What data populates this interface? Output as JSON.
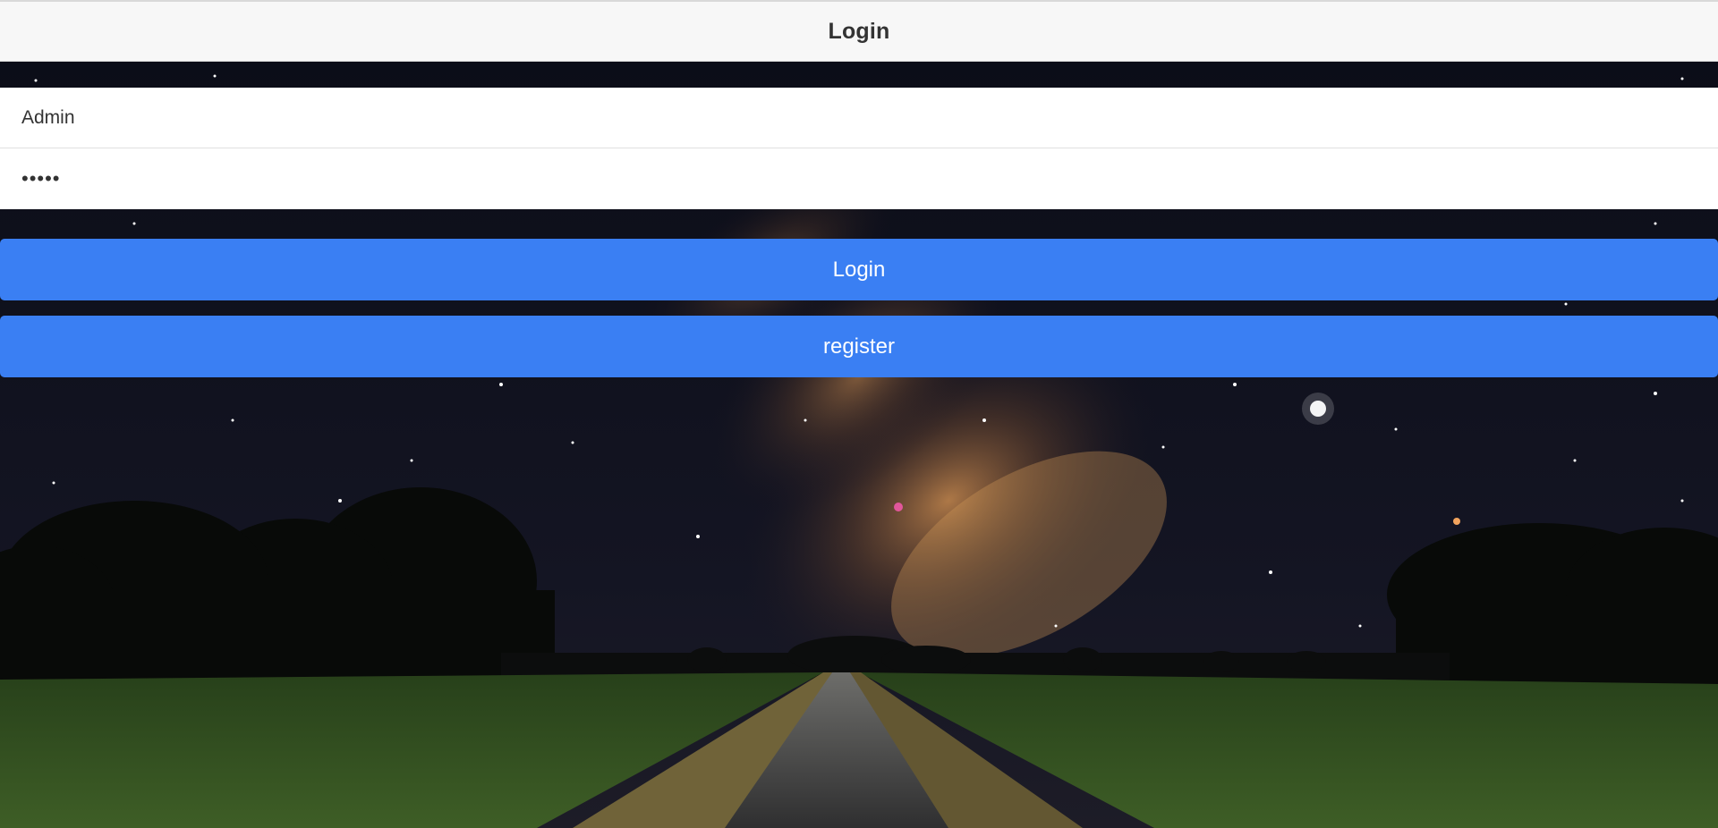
{
  "header": {
    "title": "Login"
  },
  "form": {
    "username_value": "Admin",
    "password_value": "•••••",
    "login_label": "Login",
    "register_label": "register"
  },
  "colors": {
    "button": "#3a7ff3",
    "header_bg": "#f7f7f7",
    "sky": "#05060d",
    "grass": "#2f4a1e",
    "road": "#3b3b3b"
  }
}
